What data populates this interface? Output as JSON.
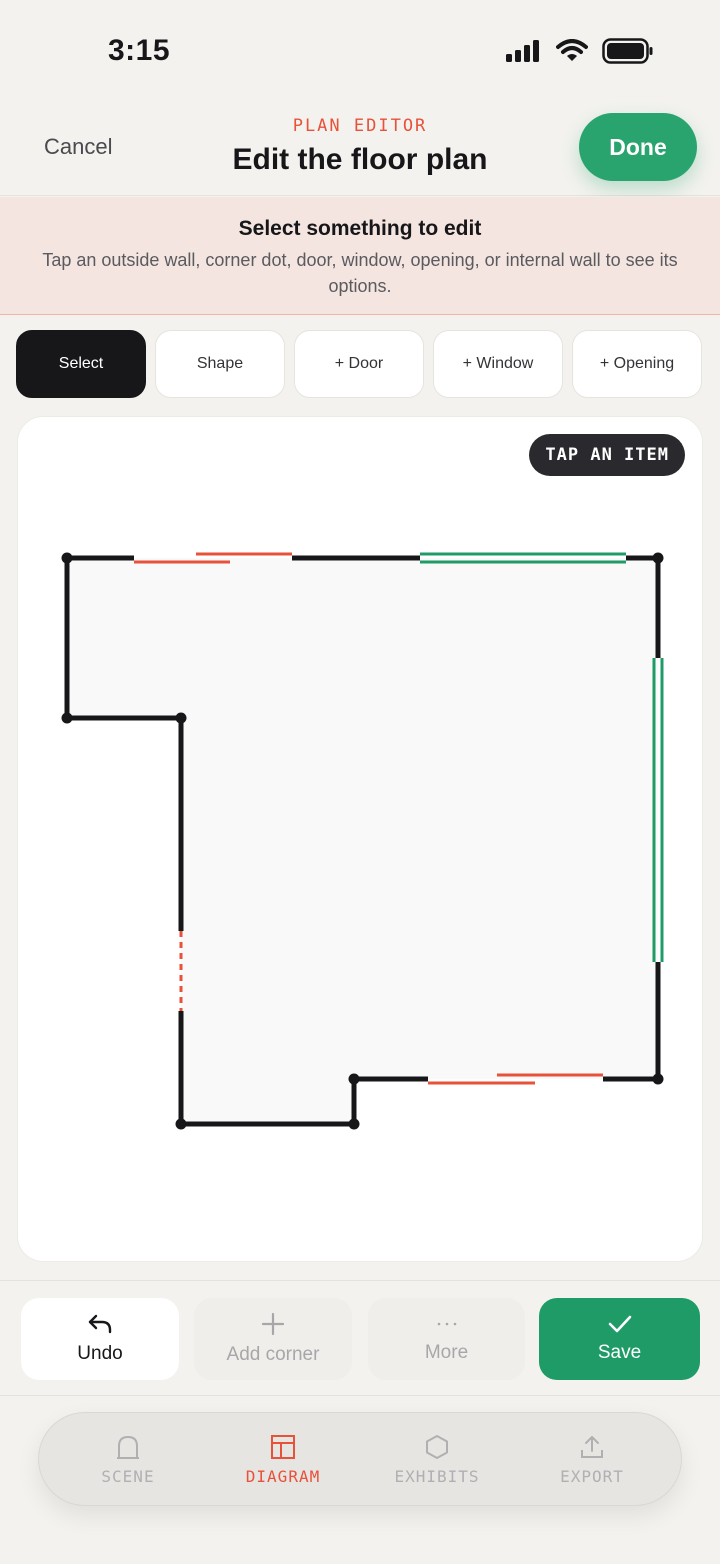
{
  "status": {
    "time": "3:15"
  },
  "header": {
    "cancel_label": "Cancel",
    "eyebrow": "PLAN EDITOR",
    "title": "Edit the floor plan",
    "done_label": "Done"
  },
  "banner": {
    "title": "Select something to edit",
    "text": "Tap an outside wall, corner dot, door, window, opening, or internal wall to see its options."
  },
  "tools": [
    {
      "label": "Select",
      "active": true
    },
    {
      "label": "Shape",
      "active": false
    },
    {
      "label": "+ Door",
      "active": false
    },
    {
      "label": "+ Window",
      "active": false
    },
    {
      "label": "+ Opening",
      "active": false
    }
  ],
  "canvas": {
    "badge": "TAP AN ITEM"
  },
  "actions": {
    "undo": {
      "label": "Undo",
      "icon": "undo-arrow-icon",
      "enabled": true
    },
    "add_corner": {
      "label": "Add corner",
      "icon": "plus-icon",
      "enabled": false
    },
    "more": {
      "label": "More",
      "icon": "ellipsis-icon",
      "enabled": false
    },
    "save": {
      "label": "Save",
      "icon": "checkmark-icon",
      "enabled": true
    }
  },
  "tabs": [
    {
      "label": "SCENE",
      "icon": "scene-icon",
      "active": false
    },
    {
      "label": "DIAGRAM",
      "icon": "diagram-icon",
      "active": true
    },
    {
      "label": "EXHIBITS",
      "icon": "hexagon-icon",
      "active": false
    },
    {
      "label": "EXPORT",
      "icon": "export-icon",
      "active": false
    }
  ],
  "colors": {
    "accent": "#e8513a",
    "primary_green": "#1f9b68",
    "wall": "#17171a",
    "window": "#1f9b68",
    "door": "#e8513a",
    "banner_bg": "#f4e5e0"
  }
}
